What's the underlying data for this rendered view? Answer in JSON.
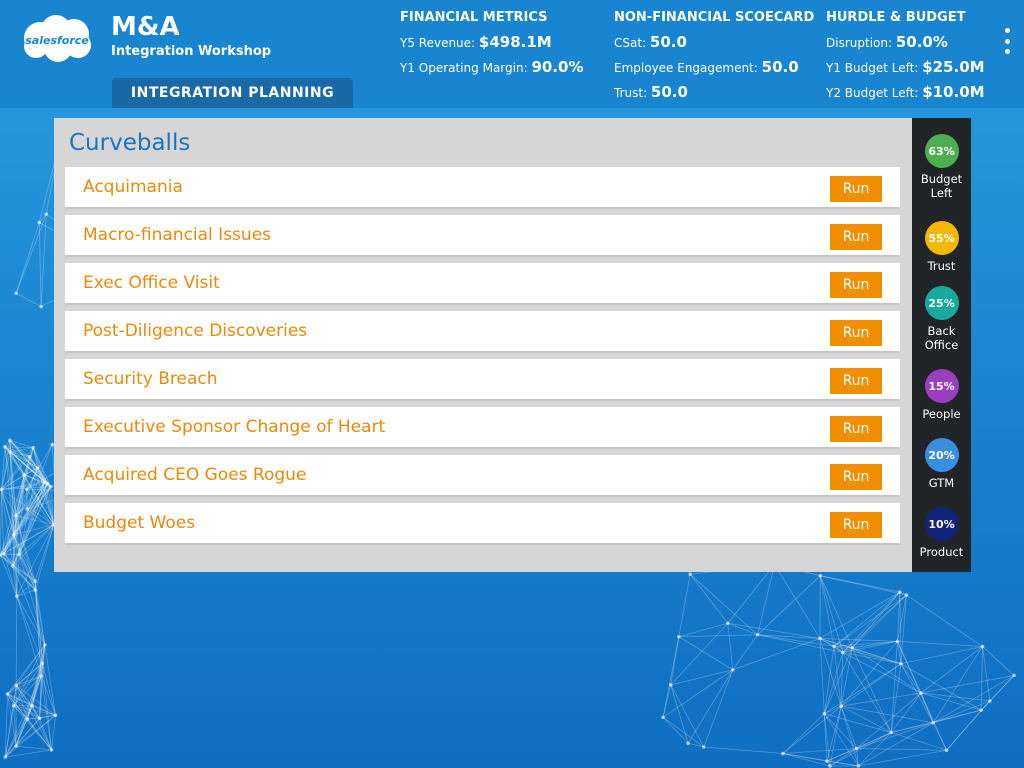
{
  "brand": {
    "logo_text": "salesforce"
  },
  "app": {
    "title": "M&A",
    "subtitle": "Integration Workshop",
    "nav_tab": "INTEGRATION PLANNING"
  },
  "metrics": [
    {
      "heading": "FINANCIAL METRICS",
      "rows": [
        {
          "label": "Y5 Revenue: ",
          "value": "$498.1M"
        },
        {
          "label": "Y1 Operating Margin: ",
          "value": "90.0%"
        }
      ]
    },
    {
      "heading": "NON-FINANCIAL SCOECARD",
      "rows": [
        {
          "label": "CSat: ",
          "value": "50.0"
        },
        {
          "label": "Employee Engagement: ",
          "value": "50.0"
        },
        {
          "label": "Trust: ",
          "value": "50.0"
        }
      ]
    },
    {
      "heading": "HURDLE & BUDGET",
      "rows": [
        {
          "label": "Disruption: ",
          "value": "50.0%"
        },
        {
          "label": "Y1 Budget Left: ",
          "value": "$25.0M"
        },
        {
          "label": "Y2 Budget Left: ",
          "value": "$10.0M"
        }
      ]
    }
  ],
  "panel": {
    "title": "Curveballs",
    "run_label": "Run",
    "items": [
      "Acquimania",
      "Macro-financial Issues",
      "Exec Office Visit",
      "Post-Diligence Discoveries",
      "Security Breach",
      "Executive Sponsor Change of Heart",
      "Acquired CEO Goes Rogue",
      "Budget Woes"
    ]
  },
  "status": [
    {
      "value": "63%",
      "label": "Budget Left",
      "color": "#4caf50"
    },
    {
      "value": "55%",
      "label": "Trust",
      "color": "#f5b800"
    },
    {
      "value": "25%",
      "label": "Back Office",
      "color": "#17a99b"
    },
    {
      "value": "15%",
      "label": "People",
      "color": "#9b3fc0"
    },
    {
      "value": "20%",
      "label": "GTM",
      "color": "#3a8ee0"
    },
    {
      "value": "10%",
      "label": "Product",
      "color": "#13237a"
    }
  ],
  "colors": {
    "header": "#1984cf",
    "tab": "#1a68a6",
    "accent_orange": "#f28f00",
    "item_text": "#e88a0c",
    "title_blue": "#1875c2"
  }
}
